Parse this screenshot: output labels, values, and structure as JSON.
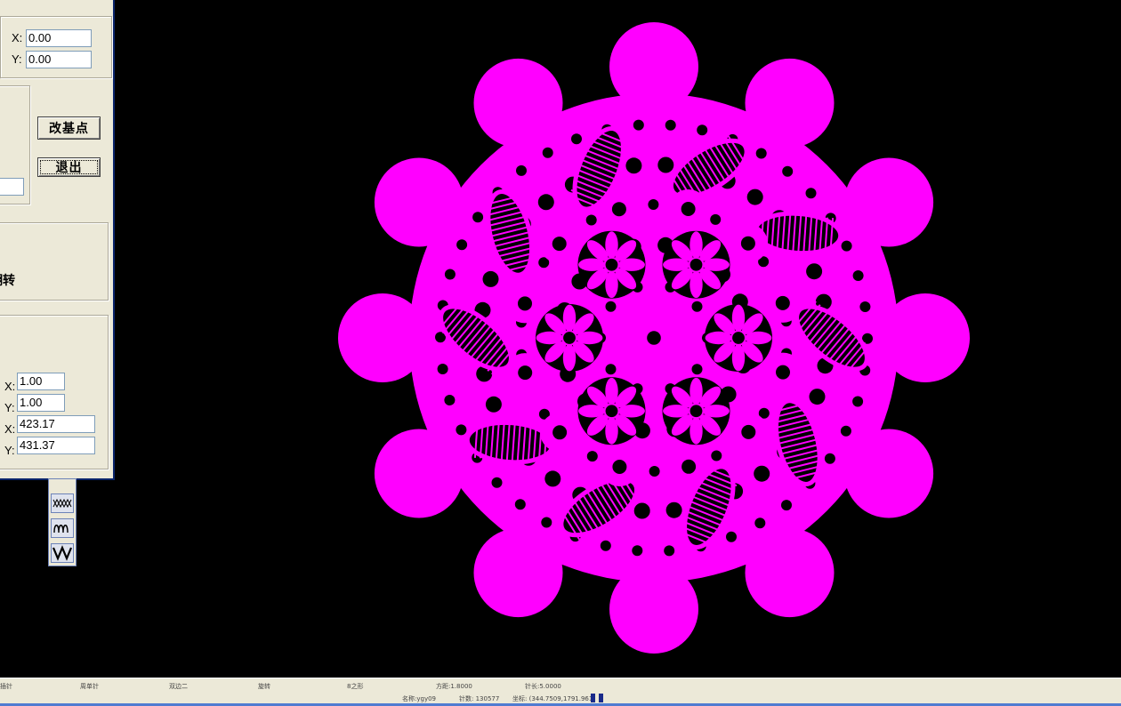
{
  "colors": {
    "lace": "#ff00ff",
    "canvas": "#000000",
    "dialog": "#ece9d8"
  },
  "dialog": {
    "base_point": {
      "x_label": "X:",
      "x_value": "0.00",
      "y_label": "Y:",
      "y_value": "0.00"
    },
    "change_base_button": "改基点",
    "exit_button": "退出",
    "flip_label": "翻转",
    "scale": {
      "x_label": "X:",
      "x_value": "1.00",
      "y_label": "Y:",
      "y_value": "1.00"
    },
    "size": {
      "x_label": "X:",
      "x_value": "423.17",
      "y_label": "Y:",
      "y_value": "431.37"
    }
  },
  "palette": {
    "tools": [
      {
        "icon": "cross-stitch-icon"
      },
      {
        "icon": "loop-stitch-icon"
      },
      {
        "icon": "zigzag-stitch-icon"
      }
    ]
  },
  "status": {
    "items": [
      "插针",
      "周单针",
      "双边二",
      "旋转",
      "8之形"
    ],
    "stitch_distance": "方距:1.8000",
    "stitch_length": "针长:5.0000",
    "name": "名称:ygy09",
    "count": "针数: 130577",
    "coords": "坐标: (344.7509,1791.961)"
  }
}
